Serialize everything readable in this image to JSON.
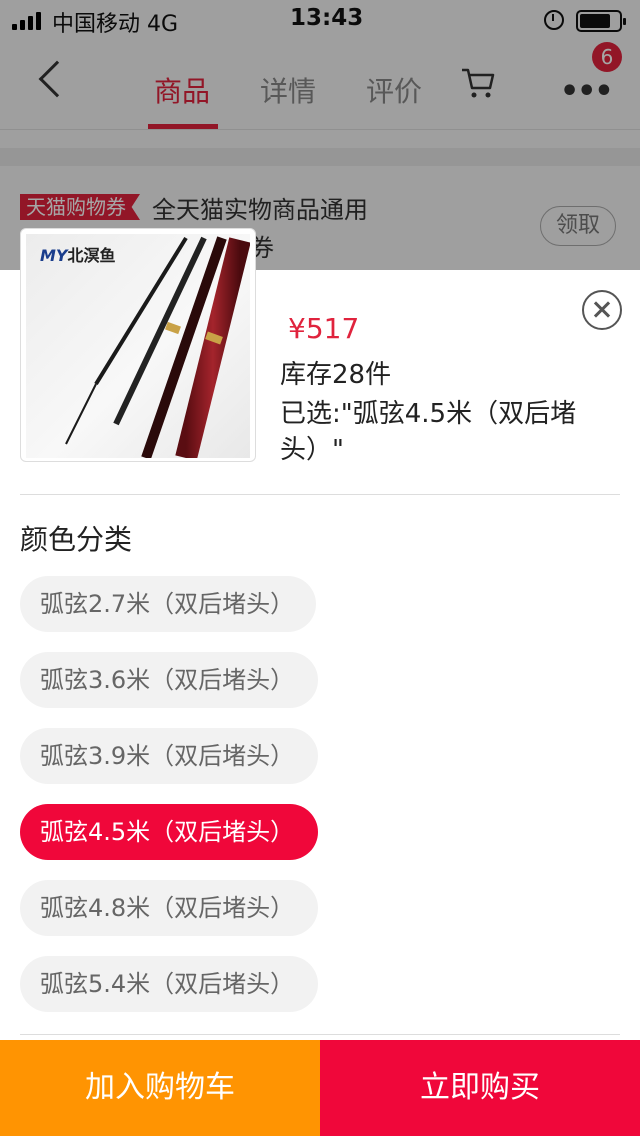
{
  "status_bar": {
    "carrier": "中国移动 4G",
    "time": "13:43"
  },
  "nav": {
    "tabs": [
      {
        "label": "商品"
      },
      {
        "label": "详情"
      },
      {
        "label": "评价"
      }
    ],
    "active_tab": "商品",
    "badge_count": "6"
  },
  "coupon": {
    "tag": "天猫购物券",
    "text_line1": "全天猫实物商品通用",
    "text_line2": "券",
    "claim_label": "领取"
  },
  "product": {
    "thumb_logo": "MY北溟鱼",
    "price": "¥517",
    "stock": "库存28件",
    "selected": "已选:\"弧弦4.5米（双后堵头）\""
  },
  "sku": {
    "title": "颜色分类",
    "options": [
      {
        "label": "弧弦2.7米（双后堵头）",
        "selected": false
      },
      {
        "label": "弧弦3.6米（双后堵头）",
        "selected": false
      },
      {
        "label": "弧弦3.9米（双后堵头）",
        "selected": false
      },
      {
        "label": "弧弦4.5米（双后堵头）",
        "selected": true
      },
      {
        "label": "弧弦4.8米（双后堵头）",
        "selected": false
      },
      {
        "label": "弧弦5.4米（双后堵头）",
        "selected": false
      }
    ]
  },
  "actions": {
    "add_to_cart": "加入购物车",
    "buy_now": "立即购买"
  },
  "colors": {
    "accent_red": "#f0073a",
    "orange": "#ff9402"
  }
}
